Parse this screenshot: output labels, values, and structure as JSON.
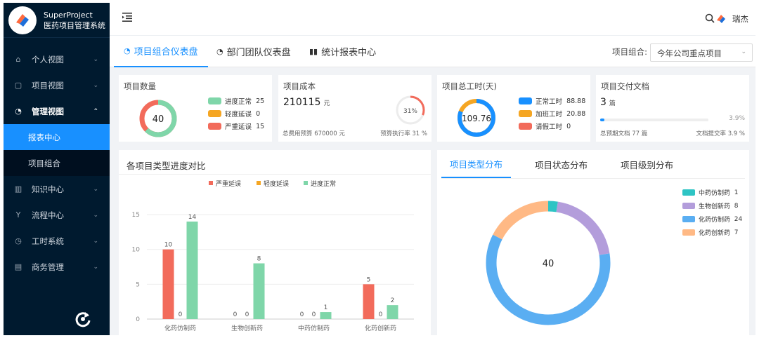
{
  "brand": {
    "title": "SuperProject",
    "subtitle": "医药项目管理系统"
  },
  "sidebar": {
    "items": [
      {
        "label": "个人视图",
        "icon": "home-icon"
      },
      {
        "label": "项目视图",
        "icon": "project-icon"
      },
      {
        "label": "管理视图",
        "icon": "dashboard-icon"
      },
      {
        "label": "知识中心",
        "icon": "book-icon"
      },
      {
        "label": "流程中心",
        "icon": "flow-icon"
      },
      {
        "label": "工时系统",
        "icon": "clock-icon"
      },
      {
        "label": "商务管理",
        "icon": "doc-icon"
      }
    ],
    "subitems": [
      "报表中心",
      "项目组合"
    ]
  },
  "header": {
    "user": "瑞杰"
  },
  "tabs": [
    {
      "label": "项目组合仪表盘",
      "icon": "dashboard-icon"
    },
    {
      "label": "部门团队仪表盘",
      "icon": "team-icon"
    },
    {
      "label": "统计报表中心",
      "icon": "bar-chart-icon"
    }
  ],
  "portfolio": {
    "label": "项目组合:",
    "value": "今年公司重点项目"
  },
  "cards": {
    "count": {
      "title": "项目数量",
      "center": "40",
      "legend": [
        {
          "label": "进度正常",
          "value": "25",
          "color": "#7fd6a9"
        },
        {
          "label": "轻度延误",
          "value": "0",
          "color": "#f5a623"
        },
        {
          "label": "严重延误",
          "value": "15",
          "color": "#f26b5b"
        }
      ]
    },
    "cost": {
      "title": "项目成本",
      "value": "210115",
      "unit": "元",
      "percent": "31%",
      "percent_num": 31,
      "budget": "总费用预算 670000 元",
      "rate": "预算执行率 31 %"
    },
    "hours": {
      "title": "项目总工时(天)",
      "center": "109.76",
      "legend": [
        {
          "label": "正常工时",
          "value": "88.88",
          "color": "#1890ff"
        },
        {
          "label": "加班工时",
          "value": "20.88",
          "color": "#f5a623"
        },
        {
          "label": "请假工时",
          "value": "0",
          "color": "#f26b5b"
        }
      ]
    },
    "docs": {
      "title": "项目交付文档",
      "value": "3",
      "unit": "篇",
      "percent": "3.9%",
      "percent_num": 3.9,
      "total": "总预期文档 77 篇",
      "rate": "文档提交率 3.9 %"
    }
  },
  "bar_panel": {
    "title": "各项目类型进度对比"
  },
  "chart_data": {
    "type": "bar",
    "categories": [
      "化药仿制药",
      "生物创新药",
      "中药仿制药",
      "化药创新药"
    ],
    "series": [
      {
        "name": "严重延误",
        "values": [
          10,
          0,
          0,
          5
        ],
        "color": "#f26b5b"
      },
      {
        "name": "轻度延误",
        "values": [
          0,
          0,
          0,
          0
        ],
        "color": "#f5a623"
      },
      {
        "name": "进度正常",
        "values": [
          14,
          8,
          1,
          2
        ],
        "color": "#7fd6a9"
      }
    ],
    "yticks": [
      "0",
      "5",
      "10",
      "15"
    ],
    "ylim": [
      0,
      15
    ],
    "grid": true,
    "legend_position": "top"
  },
  "donut_panel": {
    "tabs": [
      "项目类型分布",
      "项目状态分布",
      "项目级别分布"
    ],
    "center": "40",
    "segments": [
      {
        "label": "中药仿制药",
        "value": 1,
        "color": "#2ec4c4"
      },
      {
        "label": "生物创新药",
        "value": 8,
        "color": "#b39ddb"
      },
      {
        "label": "化药仿制药",
        "value": 24,
        "color": "#5aaef2"
      },
      {
        "label": "化药创新药",
        "value": 7,
        "color": "#ffb985"
      }
    ]
  }
}
